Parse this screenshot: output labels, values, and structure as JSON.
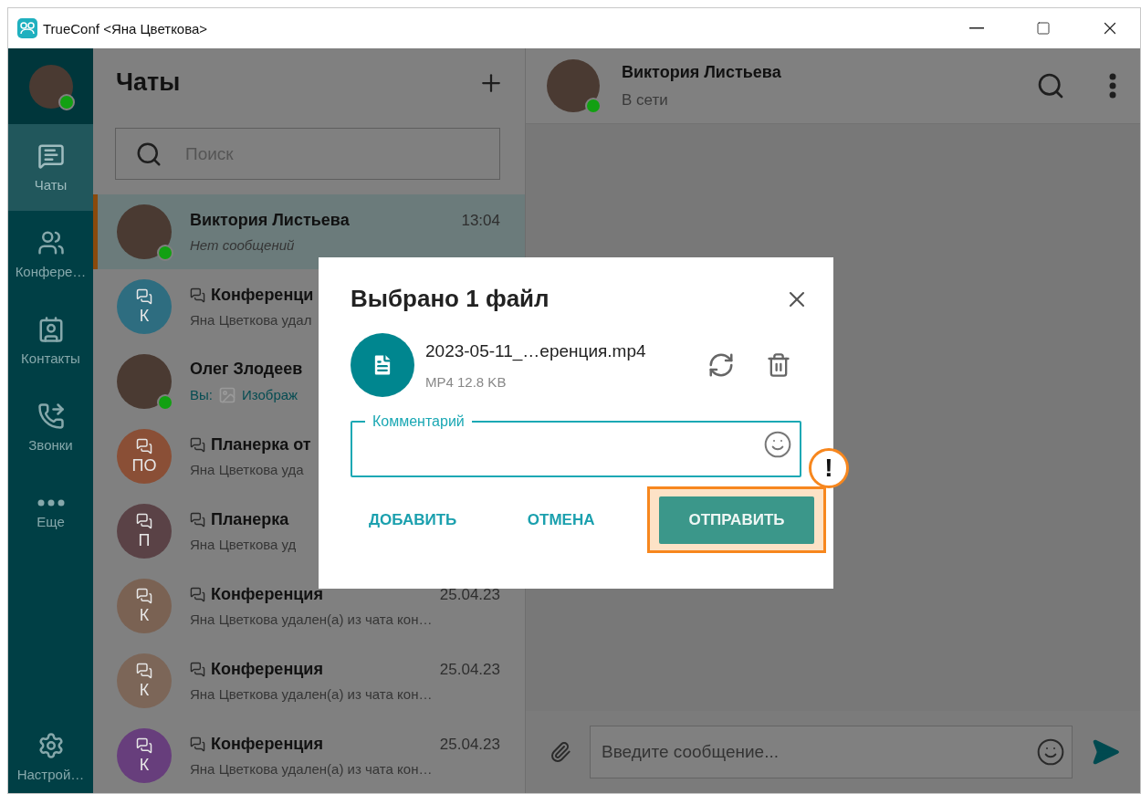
{
  "window": {
    "title": "TrueConf <Яна Цветкова>"
  },
  "nav": {
    "profile": {
      "online": true
    },
    "items": [
      {
        "kind": "chats",
        "label": "Чаты",
        "selected": true
      },
      {
        "kind": "conferences",
        "label": "Конфере…",
        "selected": false
      },
      {
        "kind": "contacts",
        "label": "Контакты",
        "selected": false
      },
      {
        "kind": "calls",
        "label": "Звонки",
        "selected": false
      },
      {
        "kind": "more",
        "label": "Еще",
        "selected": false
      }
    ],
    "settings": {
      "label": "Настрой…"
    }
  },
  "chat_list": {
    "title": "Чаты",
    "search": {
      "placeholder": "Поиск"
    },
    "chats": [
      {
        "kind": "photo",
        "name": "Виктория Листьева",
        "time": "13:04",
        "preview": "Нет сообщений",
        "no_messages": true,
        "has_attachment": false,
        "online": true,
        "selected": true
      },
      {
        "kind": "group",
        "initials": "К",
        "color": "#2e6d80",
        "name": "Конференци",
        "preview": "Яна Цветкова удал",
        "no_messages": false,
        "has_attachment": false,
        "online": false,
        "selected": false
      },
      {
        "kind": "photo",
        "name": "Олег Злодеев",
        "sender": "Вы:",
        "preview": "Изображ",
        "no_messages": false,
        "has_attachment": true,
        "online": true,
        "selected": false
      },
      {
        "kind": "group",
        "initials": "ПО",
        "color": "#8a4f36",
        "name": "Планерка от",
        "preview": "Яна Цветкова уда",
        "no_messages": false,
        "has_attachment": false,
        "online": false,
        "selected": false
      },
      {
        "kind": "group",
        "initials": "П",
        "color": "#5a4246",
        "name": "Планерка",
        "preview": "Яна Цветкова уд",
        "no_messages": false,
        "has_attachment": false,
        "online": false,
        "selected": false
      },
      {
        "kind": "group",
        "initials": "К",
        "color": "#7a6253",
        "name": "Конференция",
        "time": "25.04.23",
        "preview": "Яна Цветкова удален(а) из чата кон…",
        "no_messages": false,
        "has_attachment": false,
        "online": false,
        "selected": false
      },
      {
        "kind": "group",
        "initials": "К",
        "color": "#7c6658",
        "name": "Конференция",
        "time": "25.04.23",
        "preview": "Яна Цветкова удален(а) из чата кон…",
        "no_messages": false,
        "has_attachment": false,
        "online": false,
        "selected": false
      },
      {
        "kind": "group",
        "initials": "К",
        "color": "#673e7c",
        "name": "Конференция",
        "time": "25.04.23",
        "preview": "Яна Цветкова удален(а) из чата кон…",
        "no_messages": false,
        "has_attachment": false,
        "online": false,
        "selected": false
      }
    ]
  },
  "conversation": {
    "name": "Виктория Листьева",
    "status": "В сети",
    "online": true,
    "composer": {
      "placeholder": "Введите сообщение..."
    }
  },
  "dialog": {
    "title": "Выбрано 1 файл",
    "file": {
      "name": "2023-05-11_…еренция.mp4",
      "meta": "MP4 12.8 KB"
    },
    "comment": {
      "label": "Комментарий"
    },
    "buttons": [
      {
        "kind": "text",
        "label": "ДОБАВИТЬ",
        "highlighted": false
      },
      {
        "kind": "text",
        "label": "ОТМЕНА",
        "highlighted": false
      },
      {
        "kind": "primary",
        "label": "ОТПРАВИТЬ",
        "highlighted": true
      }
    ],
    "highlight_badge": "!"
  }
}
